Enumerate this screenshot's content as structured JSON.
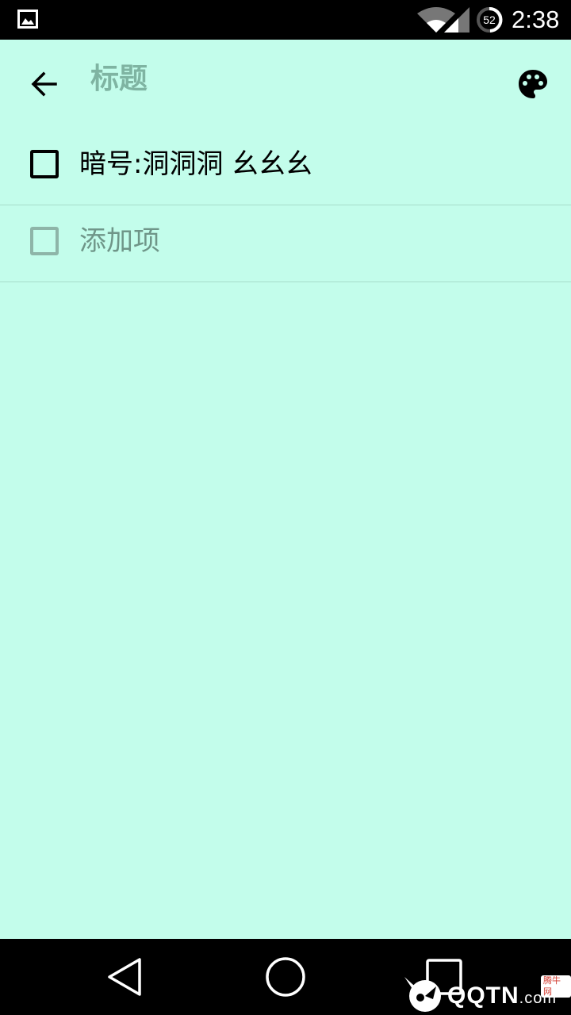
{
  "status_bar": {
    "time": "2:38",
    "battery_level": "52"
  },
  "toolbar": {
    "title_placeholder": "标题"
  },
  "checklist": {
    "items": [
      {
        "text": "暗号:洞洞洞 幺幺幺",
        "checked": false
      }
    ],
    "add_item_placeholder": "添加项"
  },
  "watermark": {
    "brand": "QQTN",
    "suffix": ".com",
    "tag": "腾牛网"
  },
  "colors": {
    "background": "#c3fdeb",
    "placeholder_text": "#7fb4a2",
    "divider": "#a7dccb"
  }
}
